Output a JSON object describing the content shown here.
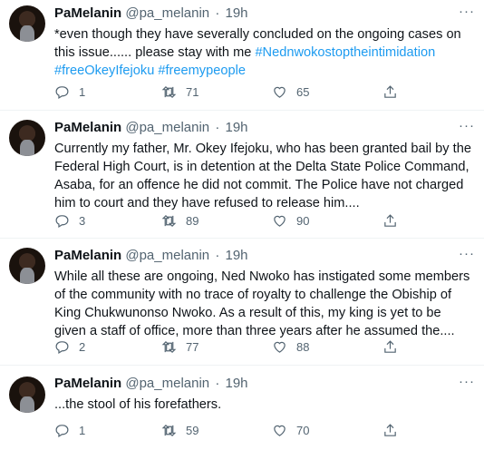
{
  "tweets": [
    {
      "name": "PaMelanin",
      "handle": "@pa_melanin",
      "time": "19h",
      "text": "*even though they have severally concluded on the ongoing cases on this issue...... please stay with me ",
      "hashtags": [
        "#Nednwokostoptheintimidation",
        "#freeOkeyIfejoku",
        "#freemypeople"
      ],
      "replies": "1",
      "retweets": "71",
      "likes": "65"
    },
    {
      "name": "PaMelanin",
      "handle": "@pa_melanin",
      "time": "19h",
      "text": "Currently my father, Mr. Okey Ifejoku, who has been granted bail by the Federal High Court, is in detention at the Delta State Police Command, Asaba, for an offence he did not commit. The Police have not charged him to court and they have refused to release him....",
      "replies": "3",
      "retweets": "89",
      "likes": "90"
    },
    {
      "name": "PaMelanin",
      "handle": "@pa_melanin",
      "time": "19h",
      "text": "While all these are ongoing, Ned Nwoko has instigated some members of the community with no trace of royalty to challenge the Obiship of King Chukwunonso Nwoko. As a result of this, my king is yet to be given a staff of office, more than three years after he assumed the....",
      "replies": "2",
      "retweets": "77",
      "likes": "88"
    },
    {
      "name": "PaMelanin",
      "handle": "@pa_melanin",
      "time": "19h",
      "text": "...the stool of his forefathers.",
      "replies": "1",
      "retweets": "59",
      "likes": "70"
    }
  ],
  "dot_separator": "·",
  "more_glyph": "···",
  "icons": [
    "reply-icon",
    "retweet-icon",
    "like-icon",
    "share-icon",
    "more-icon"
  ],
  "colors": {
    "link": "#1d9bf0",
    "muted": "#536471",
    "text": "#0f1419",
    "divider": "#eff3f4"
  }
}
